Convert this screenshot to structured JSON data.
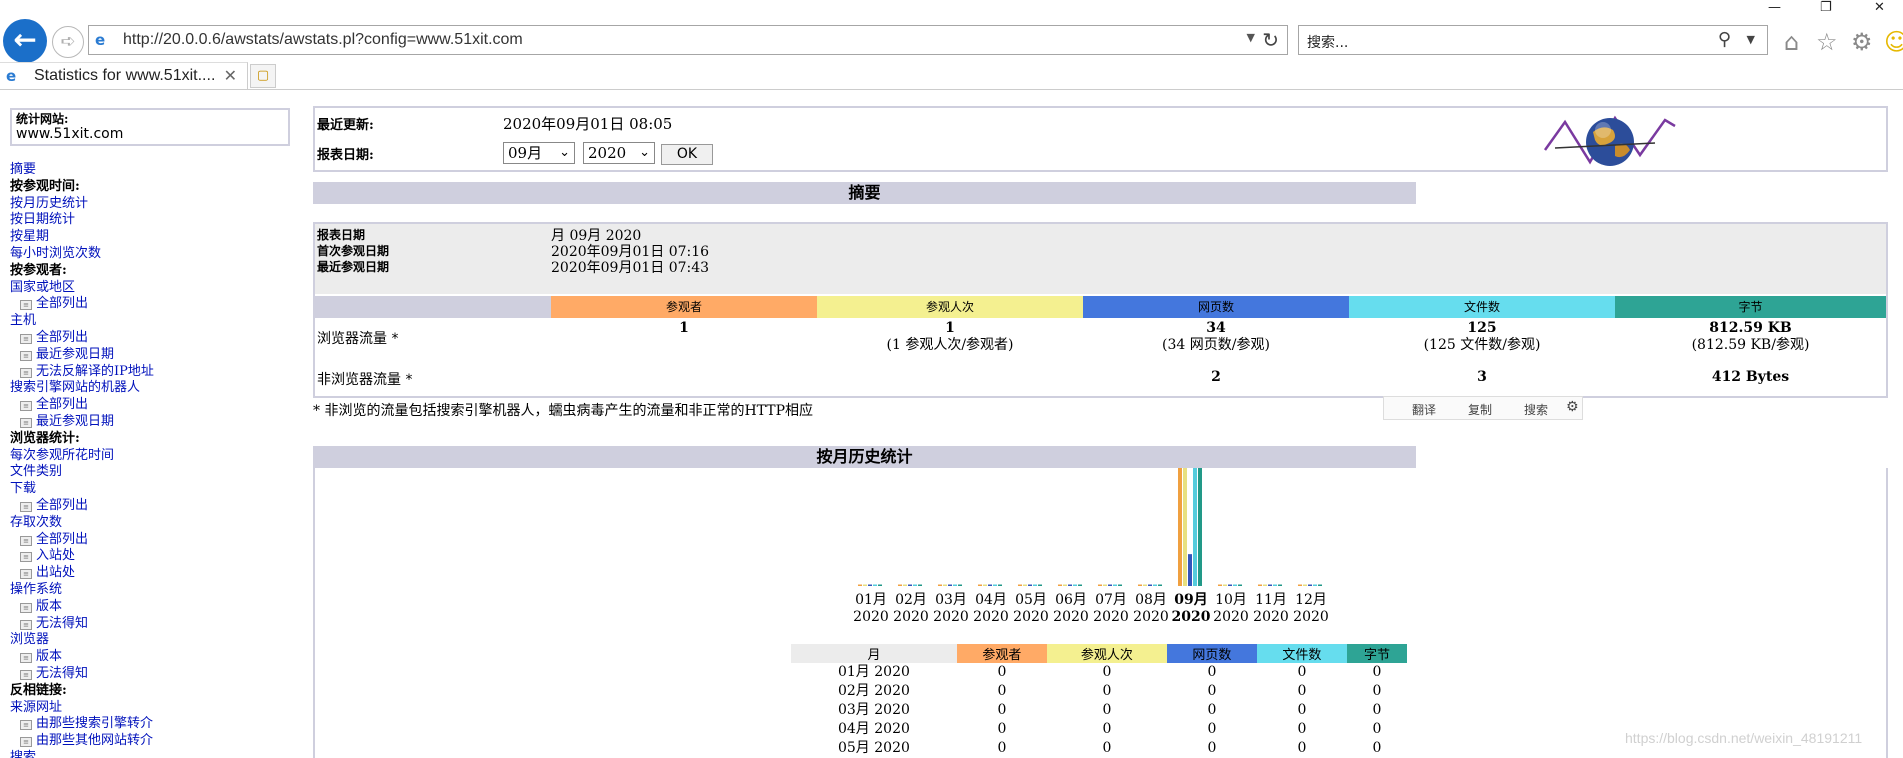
{
  "window": {
    "minimize": "—",
    "maximize": "❐",
    "close": "✕"
  },
  "toolbar": {
    "back_glyph": "←",
    "forward_glyph": "➪",
    "url": "http://20.0.0.6/awstats/awstats.pl?config=www.51xit.com",
    "search_placeholder": "搜索...",
    "refresh_glyph": "↻",
    "icons": {
      "home": "home-icon",
      "favorites": "star-icon",
      "tools": "gear-icon",
      "feedback": "smile-icon"
    }
  },
  "tab": {
    "title": "Statistics for www.51xit....",
    "close": "✕"
  },
  "menu": {
    "site_label": "统计网站:",
    "site_value": "www.51xit.com",
    "items": [
      {
        "type": "link",
        "text": "摘要"
      },
      {
        "type": "head",
        "text": "按参观时间:"
      },
      {
        "type": "link",
        "text": "按月历史统计"
      },
      {
        "type": "link",
        "text": "按日期统计"
      },
      {
        "type": "link",
        "text": "按星期"
      },
      {
        "type": "link",
        "text": "每小时浏览次数"
      },
      {
        "type": "head",
        "text": "按参观者:"
      },
      {
        "type": "link",
        "text": "国家或地区"
      },
      {
        "type": "sub",
        "text": "全部列出"
      },
      {
        "type": "link",
        "text": "主机"
      },
      {
        "type": "sub",
        "text": "全部列出"
      },
      {
        "type": "sub",
        "text": "最近参观日期"
      },
      {
        "type": "sub",
        "text": "无法反解译的IP地址"
      },
      {
        "type": "link",
        "text": "搜索引擎网站的机器人"
      },
      {
        "type": "sub",
        "text": "全部列出"
      },
      {
        "type": "sub",
        "text": "最近参观日期"
      },
      {
        "type": "head",
        "text": "浏览器统计:"
      },
      {
        "type": "link",
        "text": "每次参观所花时间"
      },
      {
        "type": "link",
        "text": "文件类别"
      },
      {
        "type": "link",
        "text": "下载"
      },
      {
        "type": "sub",
        "text": "全部列出"
      },
      {
        "type": "link",
        "text": "存取次数"
      },
      {
        "type": "sub",
        "text": "全部列出"
      },
      {
        "type": "sub",
        "text": "入站处"
      },
      {
        "type": "sub",
        "text": "出站处"
      },
      {
        "type": "link",
        "text": "操作系统"
      },
      {
        "type": "sub",
        "text": "版本"
      },
      {
        "type": "sub",
        "text": "无法得知"
      },
      {
        "type": "link",
        "text": "浏览器"
      },
      {
        "type": "sub",
        "text": "版本"
      },
      {
        "type": "sub",
        "text": "无法得知"
      },
      {
        "type": "head",
        "text": "反相链接:"
      },
      {
        "type": "link",
        "text": "来源网址"
      },
      {
        "type": "sub",
        "text": "由那些搜索引擎转介"
      },
      {
        "type": "sub",
        "text": "由那些其他网站转介"
      },
      {
        "type": "link",
        "text": "搜索"
      }
    ]
  },
  "header": {
    "last_update_label": "最近更新:",
    "last_update_value": "2020年09月01日 08:05",
    "report_date_label": "报表日期:",
    "month_selected": "09月",
    "year_selected": "2020",
    "ok_label": "OK"
  },
  "summary": {
    "title": "摘要",
    "rows": [
      {
        "label": "报表日期",
        "value": "月 09月 2020"
      },
      {
        "label": "首次参观日期",
        "value": "2020年09月01日 07:16"
      },
      {
        "label": "最近参观日期",
        "value": "2020年09月01日 07:43"
      }
    ],
    "columns": [
      {
        "label": "参观者",
        "color": "#ffaa66"
      },
      {
        "label": "参观人次",
        "color": "#f4f090"
      },
      {
        "label": "网页数",
        "color": "#4477dd"
      },
      {
        "label": "文件数",
        "color": "#66ddee"
      },
      {
        "label": "字节",
        "color": "#2ea495"
      }
    ],
    "browser_traffic_label": "浏览器流量 *",
    "browser_traffic": [
      {
        "main": "1",
        "sub": ""
      },
      {
        "main": "1",
        "sub": "(1 参观人次/参观者)"
      },
      {
        "main": "34",
        "sub": "(34 网页数/参观)"
      },
      {
        "main": "125",
        "sub": "(125 文件数/参观)"
      },
      {
        "main": "812.59 KB",
        "sub": "(812.59 KB/参观)"
      }
    ],
    "non_browser_label": "非浏览器流量 *",
    "non_browser": [
      "",
      "",
      "2",
      "3",
      "412 Bytes"
    ],
    "note": "* 非浏览的流量包括搜索引擎机器人，蠕虫病毒产生的流量和非正常的HTTP相应"
  },
  "translate_bar": {
    "translate": "翻译",
    "copy": "复制",
    "search": "搜索",
    "settings_icon": "gear-icon"
  },
  "history": {
    "title": "按月历史统计",
    "table_headers": [
      "月",
      "参观者",
      "参观人次",
      "网页数",
      "文件数",
      "字节"
    ],
    "table_rows": [
      [
        "01月 2020",
        "0",
        "0",
        "0",
        "0",
        "0"
      ],
      [
        "02月 2020",
        "0",
        "0",
        "0",
        "0",
        "0"
      ],
      [
        "03月 2020",
        "0",
        "0",
        "0",
        "0",
        "0"
      ],
      [
        "04月 2020",
        "0",
        "0",
        "0",
        "0",
        "0"
      ],
      [
        "05月 2020",
        "0",
        "0",
        "0",
        "0",
        "0"
      ]
    ]
  },
  "chart_data": {
    "type": "bar",
    "categories": [
      "01月",
      "02月",
      "03月",
      "04月",
      "05月",
      "06月",
      "07月",
      "08月",
      "09月",
      "10月",
      "11月",
      "12月"
    ],
    "category_years": [
      "2020",
      "2020",
      "2020",
      "2020",
      "2020",
      "2020",
      "2020",
      "2020",
      "2020",
      "2020",
      "2020",
      "2020"
    ],
    "highlight_category": "09月",
    "series": [
      {
        "name": "参观者",
        "color": "#f0a040",
        "relative": [
          0,
          0,
          0,
          0,
          0,
          0,
          0,
          0,
          1,
          0,
          0,
          0
        ]
      },
      {
        "name": "参观人次",
        "color": "#e8e080",
        "relative": [
          0,
          0,
          0,
          0,
          0,
          0,
          0,
          0,
          1,
          0,
          0,
          0
        ]
      },
      {
        "name": "网页数",
        "color": "#3355bb",
        "relative": [
          0,
          0,
          0,
          0,
          0,
          0,
          0,
          0,
          0.27,
          0,
          0,
          0
        ]
      },
      {
        "name": "文件数",
        "color": "#55ccdd",
        "relative": [
          0,
          0,
          0,
          0,
          0,
          0,
          0,
          0,
          1,
          0,
          0,
          0
        ]
      },
      {
        "name": "字节",
        "color": "#229988",
        "relative": [
          0,
          0,
          0,
          0,
          0,
          0,
          0,
          0,
          1,
          0,
          0,
          0
        ]
      }
    ]
  },
  "watermark": "https://blog.csdn.net/weixin_48191211"
}
